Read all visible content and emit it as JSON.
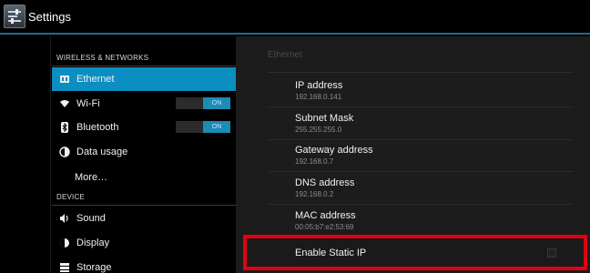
{
  "titlebar": {
    "title": "Settings",
    "icon": "settings-icon"
  },
  "sidebar": {
    "sections": [
      {
        "header": "WIRELESS & NETWORKS"
      },
      {
        "header": "DEVICE"
      }
    ],
    "items": [
      {
        "label": "Ethernet",
        "icon": "ethernet-icon",
        "active": true
      },
      {
        "label": "Wi-Fi",
        "icon": "wifi-icon",
        "toggle": "ON"
      },
      {
        "label": "Bluetooth",
        "icon": "bluetooth-icon",
        "toggle": "ON"
      },
      {
        "label": "Data usage",
        "icon": "data-usage-icon"
      },
      {
        "label": "More…"
      },
      {
        "label": "Sound",
        "icon": "sound-icon"
      },
      {
        "label": "Display",
        "icon": "display-icon"
      },
      {
        "label": "Storage",
        "icon": "storage-icon"
      }
    ]
  },
  "main": {
    "title": "Ethernet",
    "prefs": [
      {
        "title": "IP address",
        "value": "192.168.0.141"
      },
      {
        "title": "Subnet Mask",
        "value": "255.255.255.0"
      },
      {
        "title": "Gateway address",
        "value": "192.168.0.7"
      },
      {
        "title": "DNS address",
        "value": "192.168.0.2"
      },
      {
        "title": "MAC address",
        "value": "00:05:b7:e2:53:69"
      }
    ],
    "static_ip": {
      "label": "Enable Static IP",
      "checked": false
    }
  },
  "colors": {
    "accent": "#0b8ec1",
    "highlight_border": "#e2000f",
    "toggle_on": "#1c8bb5"
  }
}
